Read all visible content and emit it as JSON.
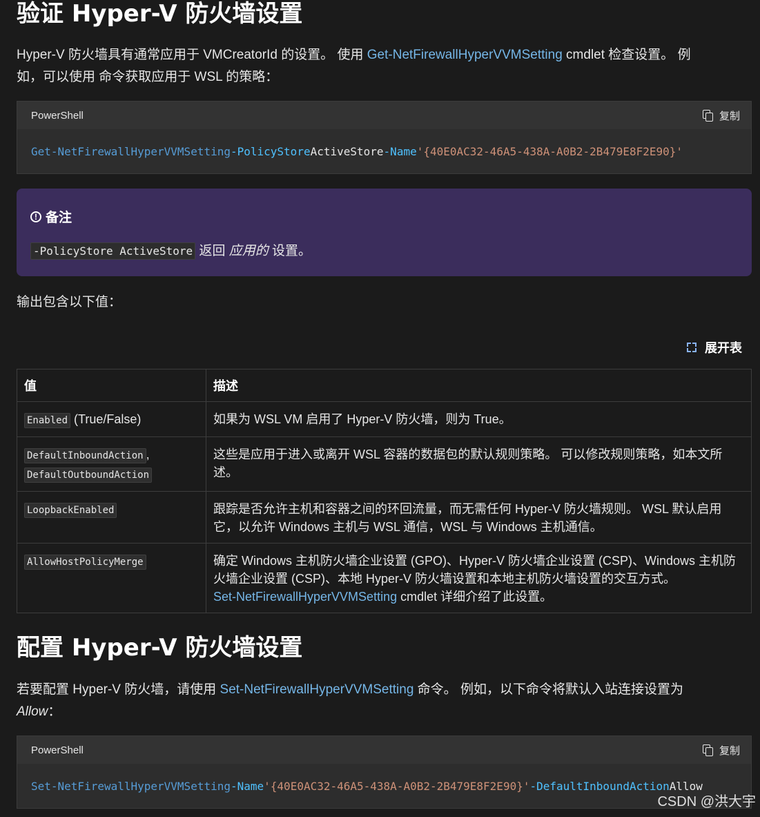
{
  "section1": {
    "heading": "验证 Hyper-V 防火墙设置",
    "intro_part1": "Hyper-V 防火墙具有通常应用于 VMCreatorId 的设置。 使用 ",
    "intro_link": "Get-NetFirewallHyperVVMSetting",
    "intro_part2": " cmdlet 检查设置。 例",
    "intro_part3": "如，可以使用 命令获取应用于 WSL 的策略："
  },
  "code1": {
    "language": "PowerShell",
    "copy_label": "复制",
    "cmd": "Get-NetFirewallHyperVVMSetting",
    "param1": "-PolicyStore",
    "value1": "ActiveStore",
    "param2": "-Name",
    "string": "'{40E0AC32-46A5-438A-A0B2-2B479E8F2E90}'"
  },
  "note": {
    "title": "备注",
    "code": "-PolicyStore ActiveStore",
    "text_before": " 返回 ",
    "text_em": "应用的",
    "text_after": " 设置。"
  },
  "output_intro": "输出包含以下值：",
  "expand_label": "展开表",
  "table": {
    "headers": [
      "值",
      "描述"
    ],
    "rows": [
      {
        "val_code": "Enabled",
        "val_text": " (True/False)",
        "desc": "如果为 WSL VM 启用了 Hyper-V 防火墙，则为 True。"
      },
      {
        "val_code": "DefaultInboundAction",
        "val_sep": ",",
        "val_code2": "DefaultOutboundAction",
        "desc": "这些是应用于进入或离开 WSL 容器的数据包的默认规则策略。 可以修改规则策略，如本文所述。"
      },
      {
        "val_code": "LoopbackEnabled",
        "desc": "跟踪是否允许主机和容器之间的环回流量，而无需任何 Hyper-V 防火墙规则。 WSL 默认启用它，以允许 Windows 主机与 WSL 通信，WSL 与 Windows 主机通信。"
      },
      {
        "val_code": "AllowHostPolicyMerge",
        "desc": "确定 Windows 主机防火墙企业设置 (GPO)、Hyper-V 防火墙企业设置 (CSP)、Windows 主机防火墙企业设置 (CSP)、本地 Hyper-V 防火墙设置和本地主机防火墙设置的交互方式。",
        "desc_link": "Set-NetFirewallHyperVVMSetting",
        "desc_after": " cmdlet 详细介绍了此设置。"
      }
    ]
  },
  "section2": {
    "heading": "配置 Hyper-V 防火墙设置",
    "intro_part1": "若要配置 Hyper-V 防火墙，请使用 ",
    "intro_link": "Set-NetFirewallHyperVVMSetting",
    "intro_part2": " 命令。 例如，以下命令将默认入站连接设置为",
    "intro_em": "Allow",
    "intro_part3": "："
  },
  "code2": {
    "language": "PowerShell",
    "copy_label": "复制",
    "cmd": "Set-NetFirewallHyperVVMSetting",
    "param1": "-Name",
    "string": "'{40E0AC32-46A5-438A-A0B2-2B479E8F2E90}'",
    "param2": "-DefaultInboundAction",
    "value2": "Allow"
  },
  "watermark": "CSDN @洪大宇"
}
